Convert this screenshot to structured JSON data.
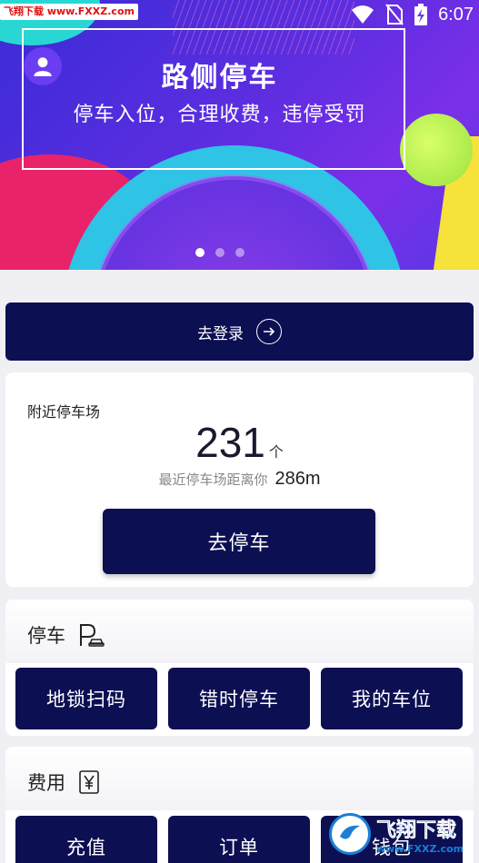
{
  "status_bar": {
    "watermark": "飞翔下载 www.FXXZ.com",
    "time": "6:07",
    "icons": [
      "wifi-icon",
      "sim-blocked-icon",
      "battery-charging-icon"
    ]
  },
  "banner": {
    "title": "路侧停车",
    "subtitle": "停车入位，合理收费，违停受罚",
    "slide_count": 3,
    "active_slide": 0
  },
  "login": {
    "label": "去登录"
  },
  "nearby": {
    "title": "附近停车场",
    "count": "231",
    "count_unit": "个",
    "distance_label": "最近停车场距离你",
    "distance_value": "286m",
    "action_label": "去停车"
  },
  "parking_section": {
    "title": "停车",
    "icon": "parking-car-icon",
    "buttons": [
      "地锁扫码",
      "错时停车",
      "我的车位"
    ]
  },
  "fee_section": {
    "title": "费用",
    "icon": "yen-icon",
    "buttons": [
      "充值",
      "订单",
      "钱包"
    ]
  },
  "watermark_bottom": {
    "main": "飞翔下载",
    "url": "www.FXXZ.com"
  },
  "colors": {
    "primary": "#0c0f52",
    "background": "#f0f0f4",
    "banner_purple": "#5a2ee0",
    "banner_cyan": "#2fc3e6",
    "banner_pink": "#e8236a"
  }
}
